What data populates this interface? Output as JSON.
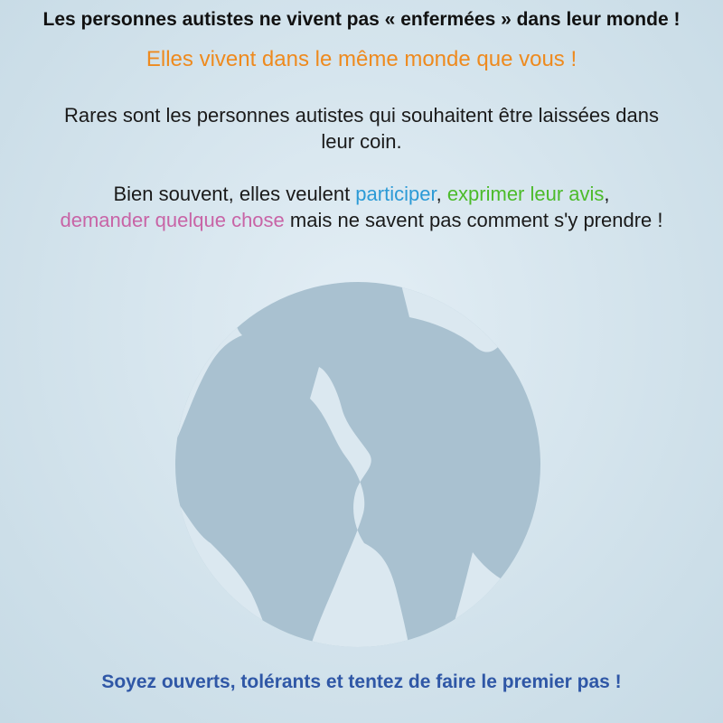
{
  "title": "Les personnes autistes ne vivent pas « enfermées » dans leur monde !",
  "subtitle": "Elles vivent dans le même monde que vous !",
  "paragraph1": "Rares sont les personnes autistes qui souhaitent être laissées dans leur coin.",
  "paragraph2": {
    "intro": "Bien souvent, elles veulent ",
    "participate": "participer",
    "sep1": ", ",
    "express": "exprimer leur avis",
    "sep2": ",",
    "ask": "demander quelque chose",
    "outro": " mais ne savent pas comment s'y prendre !"
  },
  "footer": "Soyez ouverts, tolérants et tentez de faire le premier pas !",
  "colors": {
    "subtitle": "#ee8a1e",
    "participate": "#2b9ad6",
    "express": "#4cbb2a",
    "ask": "#c864a6",
    "footer": "#2f57a6",
    "globe_ocean": "#a9c1d0",
    "globe_land": "#dbe8f0"
  },
  "illustration": "globe-icon"
}
